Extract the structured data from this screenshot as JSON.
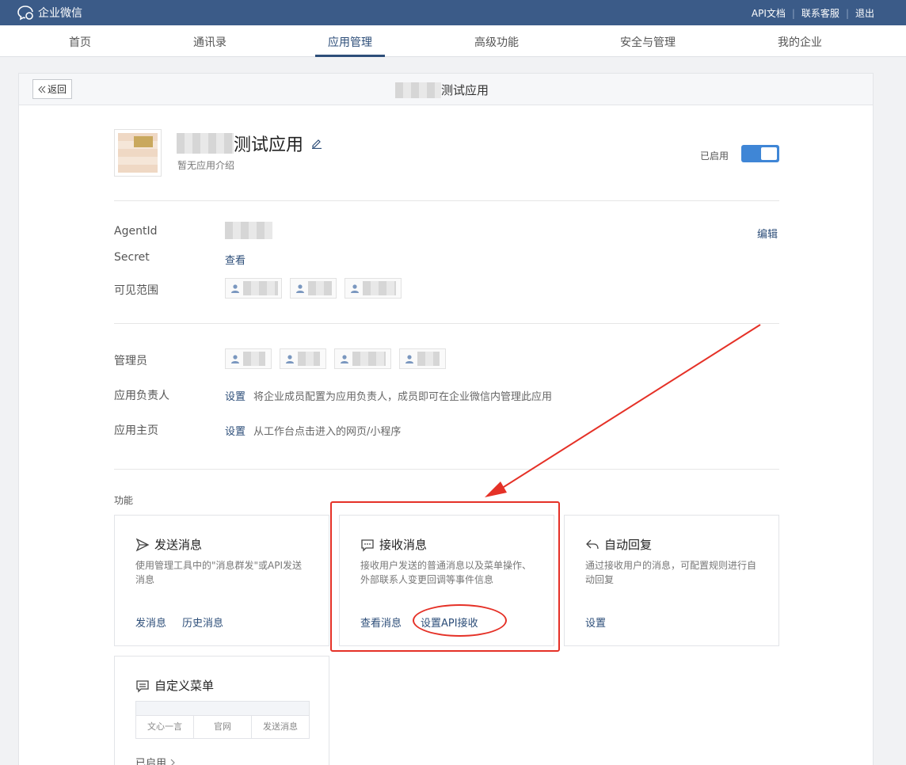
{
  "topbar": {
    "brand": "企业微信",
    "links": [
      "API文档",
      "联系客服",
      "退出"
    ],
    "sep": "|"
  },
  "nav": {
    "items": [
      "首页",
      "通讯录",
      "应用管理",
      "高级功能",
      "安全与管理",
      "我的企业"
    ],
    "active": "应用管理"
  },
  "header": {
    "back": "返回",
    "title_suffix": "测试应用"
  },
  "app": {
    "name_suffix": "测试应用",
    "description": "暂无应用介绍",
    "status_label": "已启用"
  },
  "info": {
    "agentid_label": "AgentId",
    "edit_link": "编辑",
    "secret_label": "Secret",
    "secret_link": "查看",
    "scope_label": "可见范围"
  },
  "admin": {
    "admin_label": "管理员",
    "owner_label": "应用负责人",
    "owner_link": "设置",
    "owner_hint": "将企业成员配置为应用负责人，成员即可在企业微信内管理此应用",
    "home_label": "应用主页",
    "home_link": "设置",
    "home_hint": "从工作台点击进入的网页/小程序"
  },
  "features": {
    "section_label": "功能",
    "send": {
      "title": "发送消息",
      "desc": "使用管理工具中的\"消息群发\"或API发送消息",
      "actions": [
        "发消息",
        "历史消息"
      ]
    },
    "receive": {
      "title": "接收消息",
      "desc": "接收用户发送的普通消息以及菜单操作、外部联系人变更回调等事件信息",
      "actions": [
        "查看消息",
        "设置API接收"
      ]
    },
    "autoreply": {
      "title": "自动回复",
      "desc": "通过接收用户的消息，可配置规则进行自动回复",
      "actions": [
        "设置"
      ]
    },
    "menu": {
      "title": "自定义菜单",
      "cells": [
        "文心一言",
        "官网",
        "发送消息"
      ],
      "status": "已启用"
    }
  },
  "colors": {
    "topbar": "#3b5b88",
    "link": "#2d4e79",
    "toggle": "#3f86d6",
    "annotation": "#e53127"
  }
}
